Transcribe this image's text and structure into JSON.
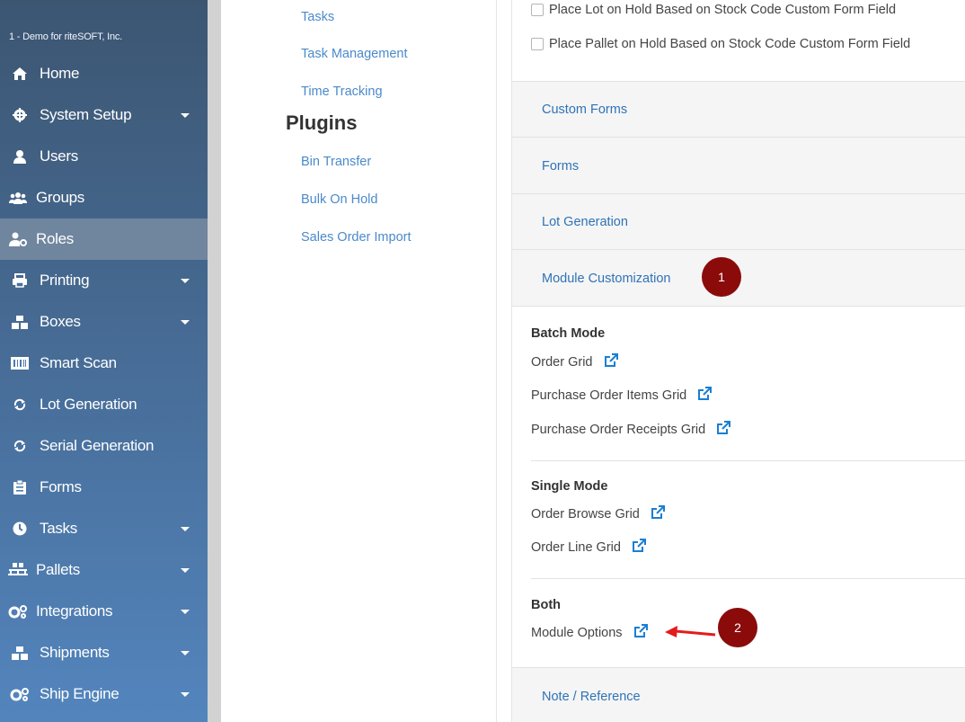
{
  "sidebar": {
    "org_name": "1 - Demo for riteSOFT, Inc.",
    "items": [
      {
        "label": "Home"
      },
      {
        "label": "System Setup",
        "has_submenu": true
      },
      {
        "label": "Users"
      },
      {
        "label": "Groups"
      },
      {
        "label": "Roles",
        "active": true
      },
      {
        "label": "Printing",
        "has_submenu": true
      },
      {
        "label": "Boxes",
        "has_submenu": true
      },
      {
        "label": "Smart Scan"
      },
      {
        "label": "Lot Generation"
      },
      {
        "label": "Serial Generation"
      },
      {
        "label": "Forms"
      },
      {
        "label": "Tasks",
        "has_submenu": true
      },
      {
        "label": "Pallets",
        "has_submenu": true
      },
      {
        "label": "Integrations",
        "has_submenu": true
      },
      {
        "label": "Shipments",
        "has_submenu": true
      },
      {
        "label": "Ship Engine",
        "has_submenu": true
      }
    ]
  },
  "middle": {
    "links_top": [
      "Tasks",
      "Task Management",
      "Time Tracking"
    ],
    "plugins_heading": "Plugins",
    "plugins": [
      "Bin Transfer",
      "Bulk On Hold",
      "Sales Order Import"
    ]
  },
  "right": {
    "checkboxes": [
      "Place Lot on Hold Based on Stock Code Custom Form Field",
      "Place Pallet on Hold Based on Stock Code Custom Form Field"
    ],
    "accordion": [
      "Custom Forms",
      "Forms",
      "Lot Generation",
      "Module Customization"
    ],
    "batch_mode": {
      "heading": "Batch Mode",
      "items": [
        "Order Grid",
        "Purchase Order Items Grid",
        "Purchase Order Receipts Grid"
      ]
    },
    "single_mode": {
      "heading": "Single Mode",
      "items": [
        "Order Browse Grid",
        "Order Line Grid"
      ]
    },
    "both": {
      "heading": "Both",
      "items": [
        "Module Options"
      ]
    },
    "bottom_accordion": "Note / Reference"
  },
  "annotations": {
    "badge1": "1",
    "badge2": "2"
  },
  "colors": {
    "badge": "#8b0b0b",
    "arrow": "#e41b1b",
    "link": "#2f73b6",
    "sidebar_top": "#3c5672",
    "sidebar_bottom": "#5385bd"
  }
}
